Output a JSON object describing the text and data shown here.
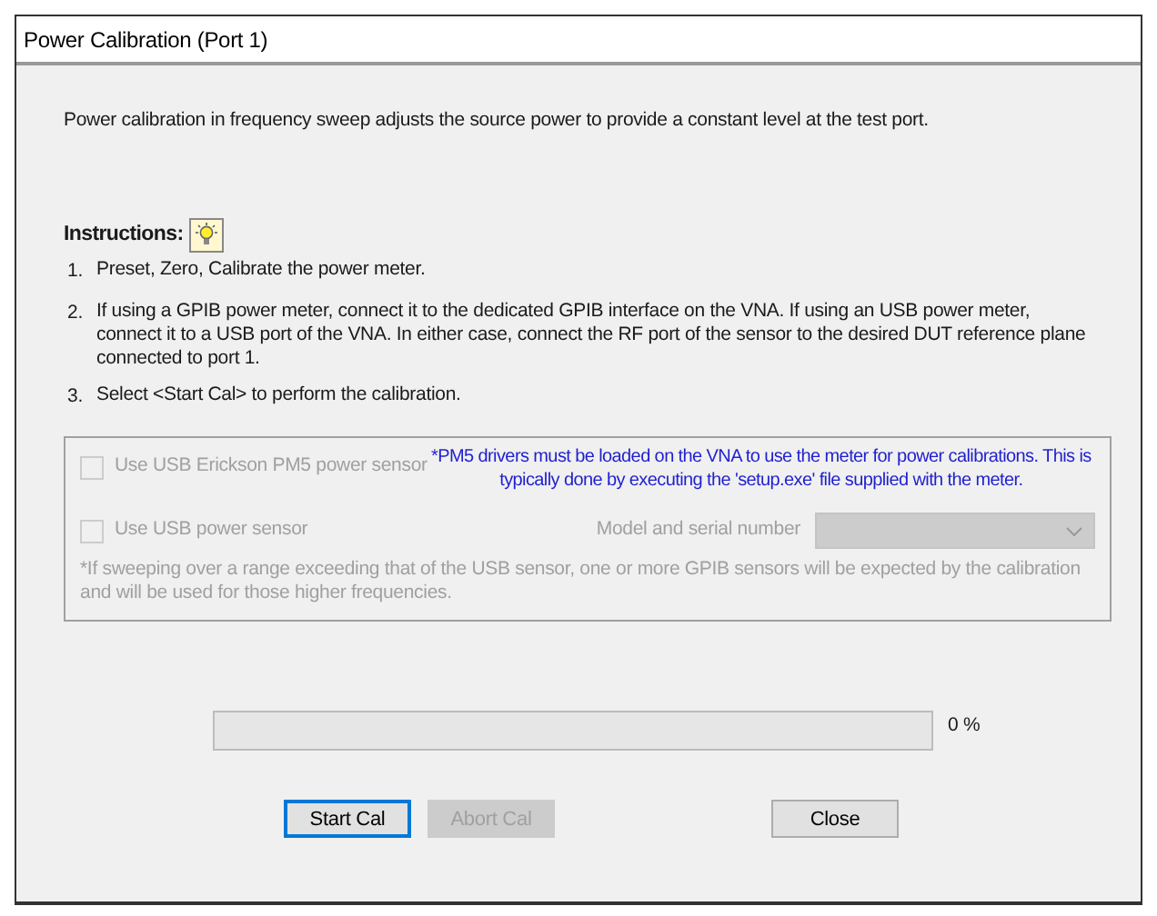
{
  "window": {
    "title": "Power Calibration (Port 1)"
  },
  "intro": "Power calibration in frequency sweep adjusts the source power to provide a constant level at the test port.",
  "instructions": {
    "heading": "Instructions:",
    "steps": [
      {
        "number": "1.",
        "text": "Preset, Zero, Calibrate the power meter."
      },
      {
        "number": "2.",
        "text": "If using a GPIB power meter, connect it to the dedicated GPIB interface on the VNA.  If using an USB power meter, connect it to a USB port of the VNA.  In either case, connect the RF port of the sensor to the desired DUT reference plane connected to port 1."
      },
      {
        "number": "3.",
        "text": "Select <Start Cal> to perform the calibration."
      }
    ]
  },
  "sensor_group": {
    "pm5_sensor": {
      "label": "Use USB Erickson PM5 power sensor",
      "checked": false,
      "disabled": true
    },
    "pm5_note": "*PM5 drivers must be loaded on the VNA to use the meter for power calibrations. This is typically done by executing the 'setup.exe' file supplied with the meter.",
    "usb_sensor": {
      "label": "Use USB power sensor",
      "checked": false,
      "disabled": true
    },
    "model_label": "Model and serial number",
    "model_dropdown": {
      "disabled": true
    },
    "footnote": "*If sweeping over a range exceeding that of the USB sensor, one or more GPIB sensors will be expected by the calibration and will be used for those higher frequencies."
  },
  "progress": {
    "level": 0,
    "reading": "0 %"
  },
  "buttons": [
    {
      "label": "Start Cal",
      "disabled": false,
      "default": true
    },
    {
      "label": "Abort Cal",
      "disabled": true,
      "default": false
    },
    {
      "label": "Close",
      "disabled": false,
      "default": false
    }
  ]
}
